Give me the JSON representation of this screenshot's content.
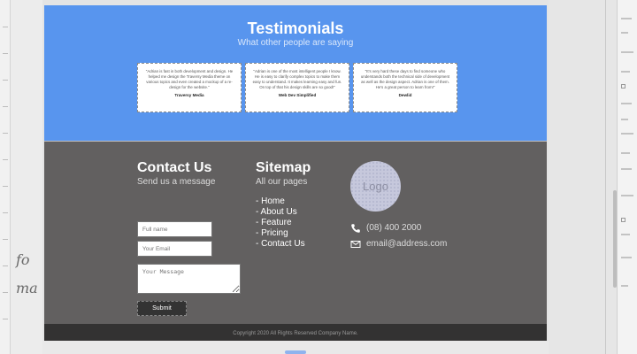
{
  "editor": {
    "handwriting": [
      "fo",
      "ma"
    ]
  },
  "testimonials": {
    "title": "Testimonials",
    "subtitle": "What other people are saying",
    "cards": [
      {
        "quote": "\"Adrian is fast in both development and design. He helped me design the Traversy Media theme on various topics and even created a mockup of a re-design for the website.\"",
        "author": "Traversy Media"
      },
      {
        "quote": "\"Adrian is one of the most intelligent people I know. He is easy to clarify complex topics to make them easy to understand. It makes learning easy and fun. On top of that his design skills are so good!\"",
        "author": "Web Dev Simplified"
      },
      {
        "quote": "\"It's very hard these days to find someone who understands both the technical side of development as well as the design aspect. Adrian is one of them. He's a great person to learn from!\"",
        "author": "Dewlid"
      }
    ]
  },
  "contact": {
    "title": "Contact Us",
    "subtitle": "Send us a message",
    "full_name_placeholder": "Full name",
    "email_placeholder": "Your Email",
    "message_placeholder": "Your Message",
    "submit_label": "Submit"
  },
  "sitemap": {
    "title": "Sitemap",
    "subtitle": "All our pages",
    "links": [
      "- Home",
      "- About Us",
      "- Feature",
      "- Pricing",
      "- Contact Us"
    ]
  },
  "info": {
    "logo_text": "Logo",
    "phone": "(08) 400 2000",
    "email": "email@address.com",
    "phone_icon": "phone-icon",
    "email_icon": "envelope-icon"
  },
  "footer": {
    "copyright": "Copyright 2020 All Rights Reserved Company Name."
  },
  "colors": {
    "testimonials_bg": "#5895ee",
    "footer_bg": "#626060",
    "copyright_bg": "#333232"
  }
}
